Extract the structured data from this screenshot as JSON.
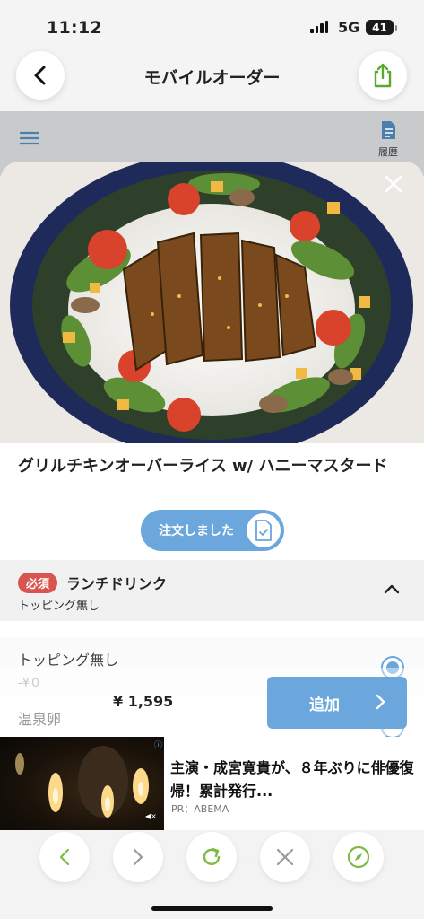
{
  "status_bar": {
    "time": "11:12",
    "network": "5G",
    "battery": "41"
  },
  "nav": {
    "title": "モバイルオーダー"
  },
  "page": {
    "history_label": "履歴"
  },
  "product": {
    "title": "グリルチキンオーバーライス w/ ハニーマスタード",
    "ordered_label": "注文しました"
  },
  "options_section": {
    "required_badge": "必須",
    "title": "ランチドリンク",
    "selected_summary": "トッピング無し",
    "options": [
      {
        "name": "トッピング無し",
        "price": "-¥０",
        "selected": true
      },
      {
        "name": "温泉卵",
        "price": "",
        "selected": false
      }
    ]
  },
  "footer": {
    "total": "¥ 1,595",
    "add_label": "追加"
  },
  "ad": {
    "headline": "主演・成宮寛貴が、８年ぶりに俳優復帰！累計発行...",
    "source": "PR：ABEMA"
  },
  "colors": {
    "accent": "#6ba6dc",
    "required": "#d9534f",
    "safari_green": "#7cba42"
  },
  "icons": [
    "back-icon",
    "share-icon",
    "menu-icon",
    "history-icon",
    "close-icon",
    "document-check-icon",
    "chevron-up-icon",
    "chevron-right-icon",
    "browser-back-icon",
    "browser-forward-icon",
    "reload-icon",
    "close-tab-icon",
    "compass-icon"
  ]
}
